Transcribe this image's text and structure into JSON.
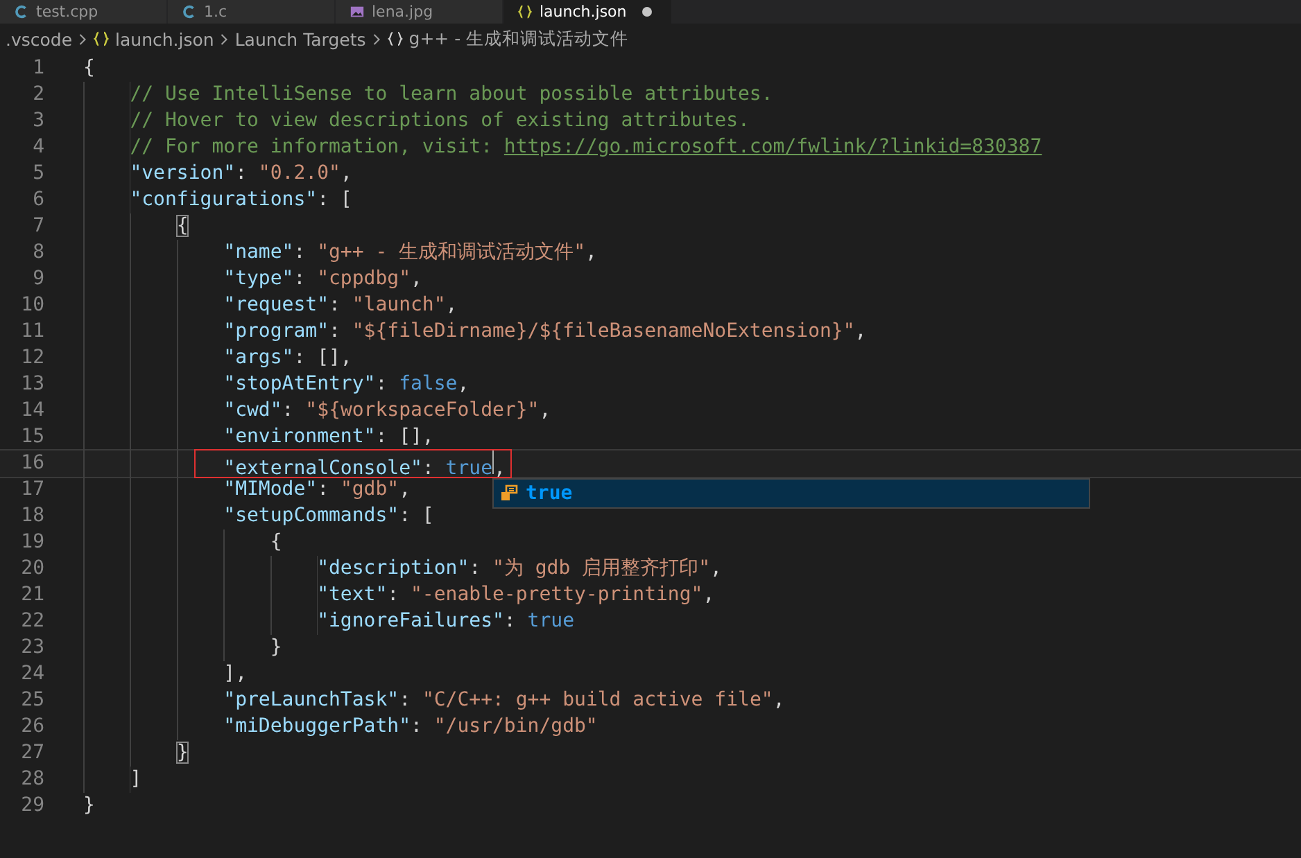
{
  "tabs": [
    {
      "label": "test.cpp",
      "kind": "c",
      "selected": false,
      "dirty": false
    },
    {
      "label": "1.c",
      "kind": "c",
      "selected": false,
      "dirty": false
    },
    {
      "label": "lena.jpg",
      "kind": "image",
      "selected": false,
      "dirty": false
    },
    {
      "label": "launch.json",
      "kind": "json",
      "selected": true,
      "dirty": true
    }
  ],
  "breadcrumb": [
    {
      "label": ".vscode",
      "kind": "folder"
    },
    {
      "label": "launch.json",
      "kind": "json"
    },
    {
      "label": "Launch Targets",
      "kind": "group"
    },
    {
      "label": "g++ - 生成和调试活动文件",
      "kind": "object"
    }
  ],
  "lines": [
    {
      "number": "1",
      "current": false,
      "annotated": false,
      "tokens": [
        {
          "kind": "punct",
          "text": "{"
        }
      ]
    },
    {
      "number": "2",
      "current": false,
      "annotated": false,
      "tokens": [
        {
          "kind": "comment",
          "text": "    // Use IntelliSense to learn about possible attributes."
        }
      ]
    },
    {
      "number": "3",
      "current": false,
      "annotated": false,
      "tokens": [
        {
          "kind": "comment",
          "text": "    // Hover to view descriptions of existing attributes."
        }
      ]
    },
    {
      "number": "4",
      "current": false,
      "annotated": false,
      "tokens": [
        {
          "kind": "comment",
          "text": "    // For more information, visit: "
        },
        {
          "kind": "link",
          "text": "https://go.microsoft.com/fwlink/?linkid=830387"
        }
      ]
    },
    {
      "number": "5",
      "current": false,
      "annotated": false,
      "tokens": [
        {
          "kind": "key",
          "text": "    \"version\""
        },
        {
          "kind": "punct",
          "text": ": "
        },
        {
          "kind": "string",
          "text": "\"0.2.0\""
        },
        {
          "kind": "punct",
          "text": ","
        }
      ]
    },
    {
      "number": "6",
      "current": false,
      "annotated": false,
      "tokens": [
        {
          "kind": "key",
          "text": "    \"configurations\""
        },
        {
          "kind": "punct",
          "text": ": ["
        }
      ]
    },
    {
      "number": "7",
      "current": false,
      "annotated": false,
      "tokens": [
        {
          "kind": "bracket-match",
          "text": "        {"
        }
      ]
    },
    {
      "number": "8",
      "current": false,
      "annotated": false,
      "tokens": [
        {
          "kind": "key",
          "text": "            \"name\""
        },
        {
          "kind": "punct",
          "text": ": "
        },
        {
          "kind": "string",
          "text": "\"g++ - 生成和调试活动文件\""
        },
        {
          "kind": "punct",
          "text": ","
        }
      ]
    },
    {
      "number": "9",
      "current": false,
      "annotated": false,
      "tokens": [
        {
          "kind": "key",
          "text": "            \"type\""
        },
        {
          "kind": "punct",
          "text": ": "
        },
        {
          "kind": "string",
          "text": "\"cppdbg\""
        },
        {
          "kind": "punct",
          "text": ","
        }
      ]
    },
    {
      "number": "10",
      "current": false,
      "annotated": false,
      "tokens": [
        {
          "kind": "key",
          "text": "            \"request\""
        },
        {
          "kind": "punct",
          "text": ": "
        },
        {
          "kind": "string",
          "text": "\"launch\""
        },
        {
          "kind": "punct",
          "text": ","
        }
      ]
    },
    {
      "number": "11",
      "current": false,
      "annotated": false,
      "tokens": [
        {
          "kind": "key",
          "text": "            \"program\""
        },
        {
          "kind": "punct",
          "text": ": "
        },
        {
          "kind": "string",
          "text": "\"${fileDirname}/${fileBasenameNoExtension}\""
        },
        {
          "kind": "punct",
          "text": ","
        }
      ]
    },
    {
      "number": "12",
      "current": false,
      "annotated": false,
      "tokens": [
        {
          "kind": "key",
          "text": "            \"args\""
        },
        {
          "kind": "punct",
          "text": ": [],"
        }
      ]
    },
    {
      "number": "13",
      "current": false,
      "annotated": false,
      "tokens": [
        {
          "kind": "key",
          "text": "            \"stopAtEntry\""
        },
        {
          "kind": "punct",
          "text": ": "
        },
        {
          "kind": "keyword",
          "text": "false"
        },
        {
          "kind": "punct",
          "text": ","
        }
      ]
    },
    {
      "number": "14",
      "current": false,
      "annotated": false,
      "tokens": [
        {
          "kind": "key",
          "text": "            \"cwd\""
        },
        {
          "kind": "punct",
          "text": ": "
        },
        {
          "kind": "string",
          "text": "\"${workspaceFolder}\""
        },
        {
          "kind": "punct",
          "text": ","
        }
      ]
    },
    {
      "number": "15",
      "current": false,
      "annotated": false,
      "tokens": [
        {
          "kind": "key",
          "text": "            \"environment\""
        },
        {
          "kind": "punct",
          "text": ": [],"
        }
      ]
    },
    {
      "number": "16",
      "current": true,
      "annotated": true,
      "tokens": [
        {
          "kind": "key",
          "text": "            \"externalConsole\""
        },
        {
          "kind": "punct",
          "text": ": "
        },
        {
          "kind": "keyword",
          "text": "true"
        },
        {
          "kind": "punct",
          "text": ","
        }
      ]
    },
    {
      "number": "17",
      "current": false,
      "annotated": false,
      "tokens": [
        {
          "kind": "key",
          "text": "            \"MIMode\""
        },
        {
          "kind": "punct",
          "text": ": "
        },
        {
          "kind": "string",
          "text": "\"gdb\""
        },
        {
          "kind": "punct",
          "text": ","
        }
      ]
    },
    {
      "number": "18",
      "current": false,
      "annotated": false,
      "tokens": [
        {
          "kind": "key",
          "text": "            \"setupCommands\""
        },
        {
          "kind": "punct",
          "text": ": ["
        }
      ]
    },
    {
      "number": "19",
      "current": false,
      "annotated": false,
      "tokens": [
        {
          "kind": "punct",
          "text": "                {"
        }
      ]
    },
    {
      "number": "20",
      "current": false,
      "annotated": false,
      "tokens": [
        {
          "kind": "key",
          "text": "                    \"description\""
        },
        {
          "kind": "punct",
          "text": ": "
        },
        {
          "kind": "string",
          "text": "\"为 gdb 启用整齐打印\""
        },
        {
          "kind": "punct",
          "text": ","
        }
      ]
    },
    {
      "number": "21",
      "current": false,
      "annotated": false,
      "tokens": [
        {
          "kind": "key",
          "text": "                    \"text\""
        },
        {
          "kind": "punct",
          "text": ": "
        },
        {
          "kind": "string",
          "text": "\"-enable-pretty-printing\""
        },
        {
          "kind": "punct",
          "text": ","
        }
      ]
    },
    {
      "number": "22",
      "current": false,
      "annotated": false,
      "tokens": [
        {
          "kind": "key",
          "text": "                    \"ignoreFailures\""
        },
        {
          "kind": "punct",
          "text": ": "
        },
        {
          "kind": "keyword",
          "text": "true"
        }
      ]
    },
    {
      "number": "23",
      "current": false,
      "annotated": false,
      "tokens": [
        {
          "kind": "punct",
          "text": "                }"
        }
      ]
    },
    {
      "number": "24",
      "current": false,
      "annotated": false,
      "tokens": [
        {
          "kind": "punct",
          "text": "            ],"
        }
      ]
    },
    {
      "number": "25",
      "current": false,
      "annotated": false,
      "tokens": [
        {
          "kind": "key",
          "text": "            \"preLaunchTask\""
        },
        {
          "kind": "punct",
          "text": ": "
        },
        {
          "kind": "string",
          "text": "\"C/C++: g++ build active file\""
        },
        {
          "kind": "punct",
          "text": ","
        }
      ]
    },
    {
      "number": "26",
      "current": false,
      "annotated": false,
      "tokens": [
        {
          "kind": "key",
          "text": "            \"miDebuggerPath\""
        },
        {
          "kind": "punct",
          "text": ": "
        },
        {
          "kind": "string",
          "text": "\"/usr/bin/gdb\""
        }
      ]
    },
    {
      "number": "27",
      "current": false,
      "annotated": false,
      "tokens": [
        {
          "kind": "bracket-match",
          "text": "        }"
        }
      ]
    },
    {
      "number": "28",
      "current": false,
      "annotated": false,
      "tokens": [
        {
          "kind": "punct",
          "text": "    ]"
        }
      ]
    },
    {
      "number": "29",
      "current": false,
      "annotated": false,
      "tokens": [
        {
          "kind": "punct",
          "text": "}"
        }
      ]
    }
  ],
  "suggestions": [
    {
      "label": "true",
      "selected": true
    }
  ]
}
